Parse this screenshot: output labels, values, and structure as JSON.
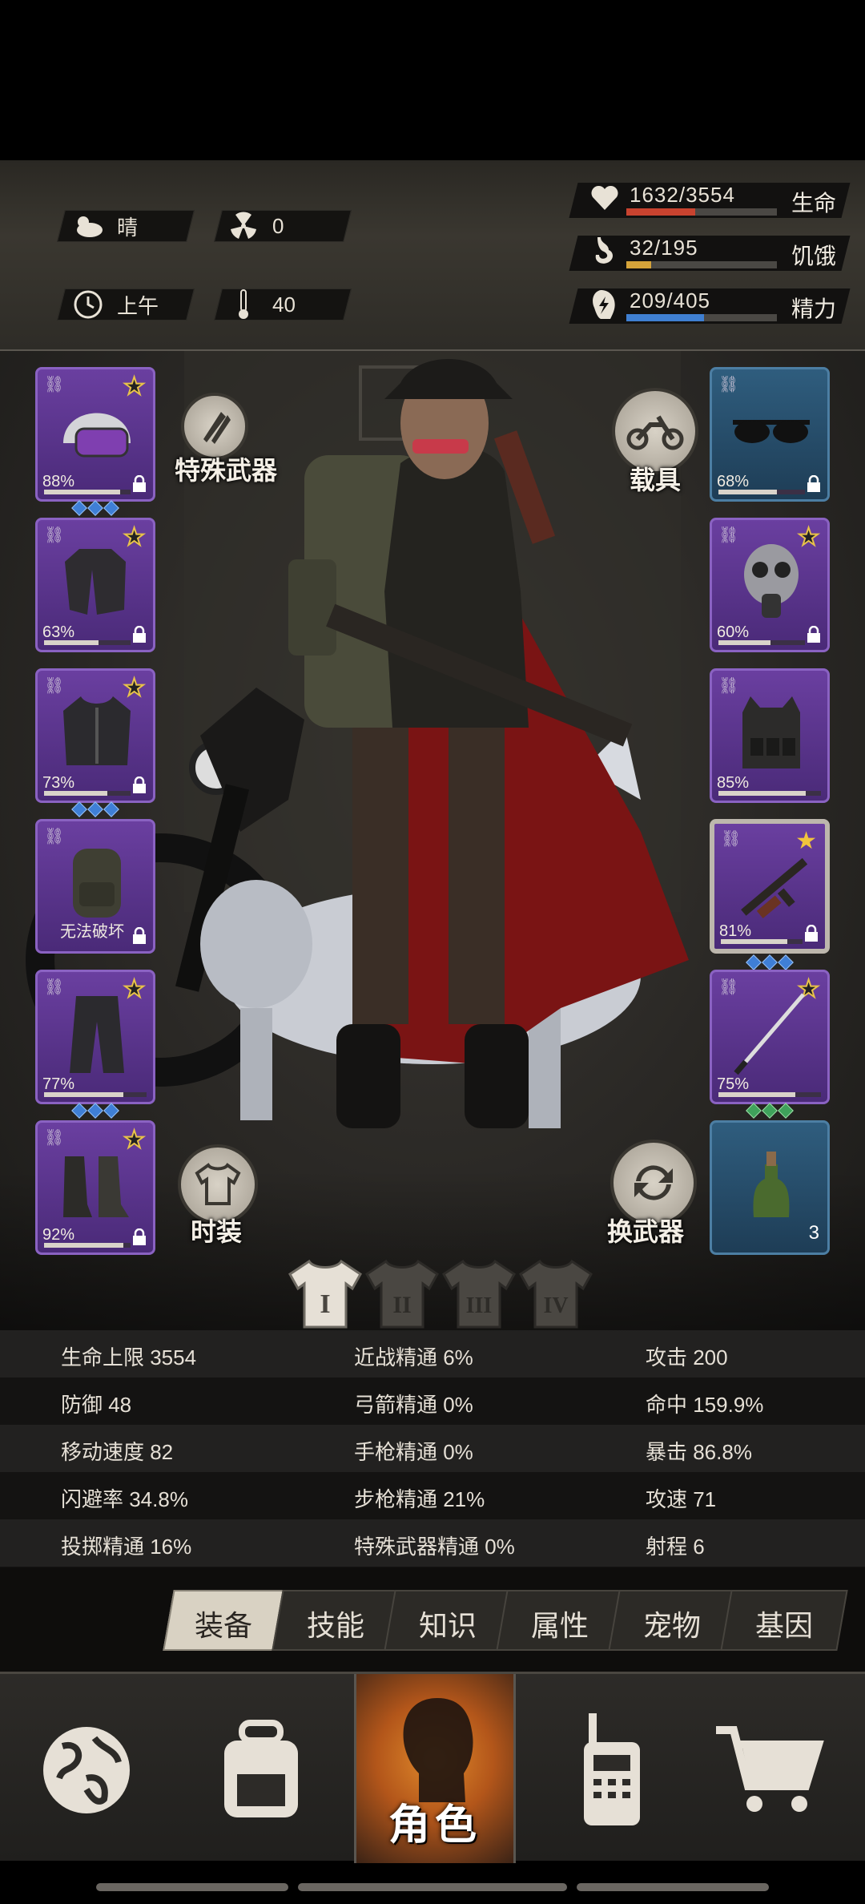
{
  "header": {
    "weather": {
      "icon": "cloud-sun-icon",
      "label": "晴"
    },
    "radiation": {
      "icon": "radiation-icon",
      "value": "0"
    },
    "time_of_day": {
      "icon": "clock-icon",
      "label": "上午"
    },
    "temperature": {
      "icon": "thermometer-icon",
      "value": "40"
    },
    "stats": [
      {
        "icon": "heart-icon",
        "value": "1632/3554",
        "label": "生命",
        "fraction": 0.459,
        "color": "#c8432f"
      },
      {
        "icon": "stomach-icon",
        "value": "32/195",
        "label": "饥饿",
        "fraction": 0.164,
        "color": "#d6a43a"
      },
      {
        "icon": "energy-icon",
        "value": "209/405",
        "label": "精力",
        "fraction": 0.516,
        "color": "#3f7fd1"
      }
    ]
  },
  "equipment": {
    "left": [
      {
        "name": "helmet",
        "pct": "88%",
        "fraction": 0.88,
        "star": true,
        "locked": true,
        "gems": 3
      },
      {
        "name": "shirt",
        "pct": "63%",
        "fraction": 0.63,
        "star": true,
        "locked": true,
        "gems": 0
      },
      {
        "name": "jacket",
        "pct": "73%",
        "fraction": 0.73,
        "star": true,
        "locked": true,
        "gems": 3
      },
      {
        "name": "backpack",
        "broken_label": "无法破坏",
        "star": false,
        "locked": true,
        "gems": 0
      },
      {
        "name": "pants",
        "pct": "77%",
        "fraction": 0.77,
        "star": true,
        "locked": false,
        "gems": 3
      },
      {
        "name": "boots",
        "pct": "92%",
        "fraction": 0.92,
        "star": true,
        "locked": true,
        "gems": 0
      }
    ],
    "right": [
      {
        "name": "sunglasses",
        "pct": "68%",
        "fraction": 0.68,
        "star": false,
        "locked": true,
        "gems": 0
      },
      {
        "name": "gas-mask",
        "pct": "60%",
        "fraction": 0.6,
        "star": true,
        "locked": true,
        "gems": 0
      },
      {
        "name": "vest",
        "pct": "85%",
        "fraction": 0.85,
        "star": false,
        "locked": false,
        "gems": 0
      },
      {
        "name": "rifle",
        "pct": "81%",
        "fraction": 0.81,
        "star": true,
        "locked": true,
        "gems": 3
      },
      {
        "name": "sword",
        "pct": "75%",
        "fraction": 0.75,
        "star": true,
        "locked": false,
        "gems": 3
      },
      {
        "name": "molotov",
        "count": "3"
      }
    ]
  },
  "buttons": {
    "special_weapon": "特殊武器",
    "vehicle": "载具",
    "fashion": "时装",
    "switch_weapon": "换武器"
  },
  "outfit_tabs": [
    "I",
    "II",
    "III",
    "IV"
  ],
  "attributes": [
    [
      "生命上限 3554",
      "近战精通 6%",
      "攻击 200"
    ],
    [
      "防御 48",
      "弓箭精通 0%",
      "命中 159.9%"
    ],
    [
      "移动速度 82",
      "手枪精通 0%",
      "暴击 86.8%"
    ],
    [
      "闪避率 34.8%",
      "步枪精通 21%",
      "攻速 71"
    ],
    [
      "投掷精通 16%",
      "特殊武器精通 0%",
      "射程 6"
    ]
  ],
  "tabs": [
    "装备",
    "技能",
    "知识",
    "属性",
    "宠物",
    "基因"
  ],
  "nav": {
    "items": [
      "globe-icon",
      "backpack-icon",
      "character-icon",
      "radio-icon",
      "cart-icon"
    ],
    "active_label": "角色"
  }
}
